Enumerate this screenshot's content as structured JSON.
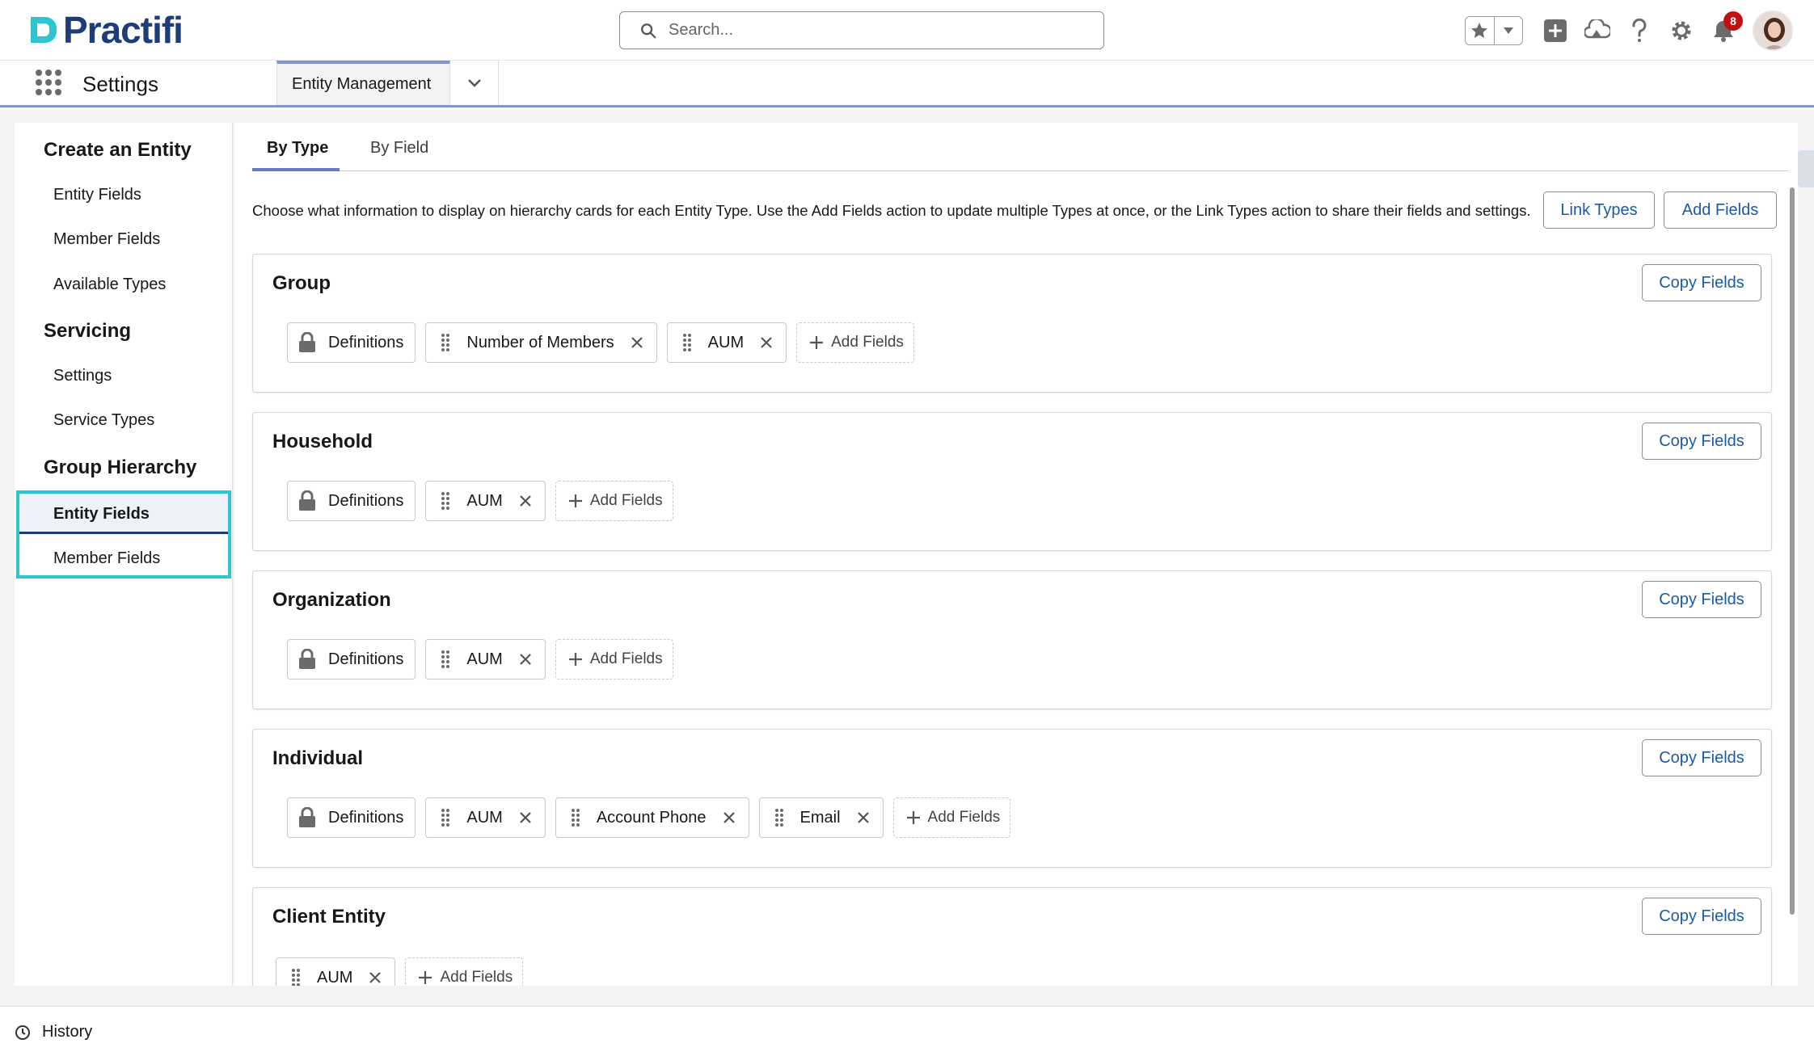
{
  "header": {
    "brand": "Practifi",
    "search_placeholder": "Search...",
    "notification_count": "8"
  },
  "nav": {
    "app_name": "Settings",
    "tab_label": "Entity Management"
  },
  "sidebar": {
    "sections": [
      {
        "title": "Create an Entity",
        "items": [
          "Entity Fields",
          "Member Fields",
          "Available Types"
        ]
      },
      {
        "title": "Servicing",
        "items": [
          "Settings",
          "Service Types"
        ]
      },
      {
        "title": "Group Hierarchy",
        "items": [
          "Entity Fields",
          "Member Fields"
        ]
      }
    ],
    "active_item": "Entity Fields"
  },
  "content": {
    "tabs": [
      "By Type",
      "By Field"
    ],
    "active_tab": "By Type",
    "description": "Choose what information to display on hierarchy cards for each Entity Type. Use the Add Fields action to update multiple Types at once, or the Link Types action to share their fields and settings.",
    "link_types_label": "Link Types",
    "add_fields_label": "Add Fields",
    "copy_fields_label": "Copy Fields",
    "add_fields_chip_label": "Add Fields",
    "cards": [
      {
        "title": "Group",
        "locked": "Definitions",
        "fields": [
          "Number of Members",
          "AUM"
        ]
      },
      {
        "title": "Household",
        "locked": "Definitions",
        "fields": [
          "AUM"
        ]
      },
      {
        "title": "Organization",
        "locked": "Definitions",
        "fields": [
          "AUM"
        ]
      },
      {
        "title": "Individual",
        "locked": "Definitions",
        "fields": [
          "AUM",
          "Account Phone",
          "Email"
        ]
      },
      {
        "title": "Client Entity",
        "locked": "",
        "fields": [
          "AUM"
        ]
      }
    ]
  },
  "footer": {
    "history_label": "History"
  },
  "colors": {
    "brand": "#1d3d7a",
    "logo_accent": "#2fc5d0",
    "highlight": "#2fc5d0",
    "link": "#1b5aa8",
    "tab_accent": "#6779c9",
    "badge": "#c20f0f"
  }
}
